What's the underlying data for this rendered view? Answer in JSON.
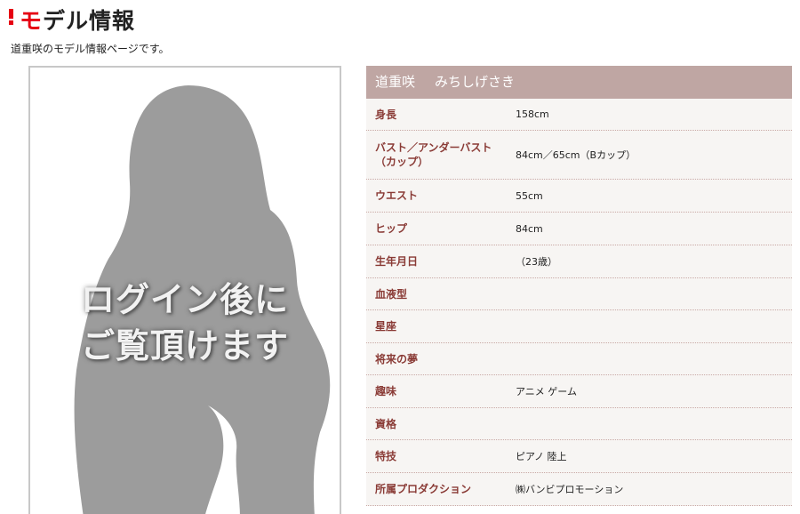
{
  "header": {
    "title_first_char": "モ",
    "title_rest": "デル情報",
    "subtitle": "道重咲のモデル情報ページです。"
  },
  "photo": {
    "caption_line1": "ログイン後に",
    "caption_line2": "ご覧頂けます"
  },
  "profile": {
    "name": "道重咲",
    "kana": "みちしげさき",
    "rows": [
      {
        "label": "身長",
        "value": "158cm"
      },
      {
        "label": "バスト／アンダーバスト\n（カップ）",
        "value": "84cm／65cm（Bカップ）"
      },
      {
        "label": "ウエスト",
        "value": "55cm"
      },
      {
        "label": "ヒップ",
        "value": "84cm"
      },
      {
        "label": "生年月日",
        "value": "（23歳）"
      },
      {
        "label": "血液型",
        "value": ""
      },
      {
        "label": "星座",
        "value": ""
      },
      {
        "label": "将来の夢",
        "value": ""
      },
      {
        "label": "趣味",
        "value": "アニメ ゲーム"
      },
      {
        "label": "資格",
        "value": ""
      },
      {
        "label": "特技",
        "value": "ピアノ 陸上"
      },
      {
        "label": "所属プロダクション",
        "value": "㈱バンビプロモーション"
      }
    ]
  },
  "colors": {
    "accent_red": "#e60012",
    "header_bg": "#bfa6a3",
    "label_text": "#8a3b36",
    "row_bg": "#f7f5f3"
  }
}
